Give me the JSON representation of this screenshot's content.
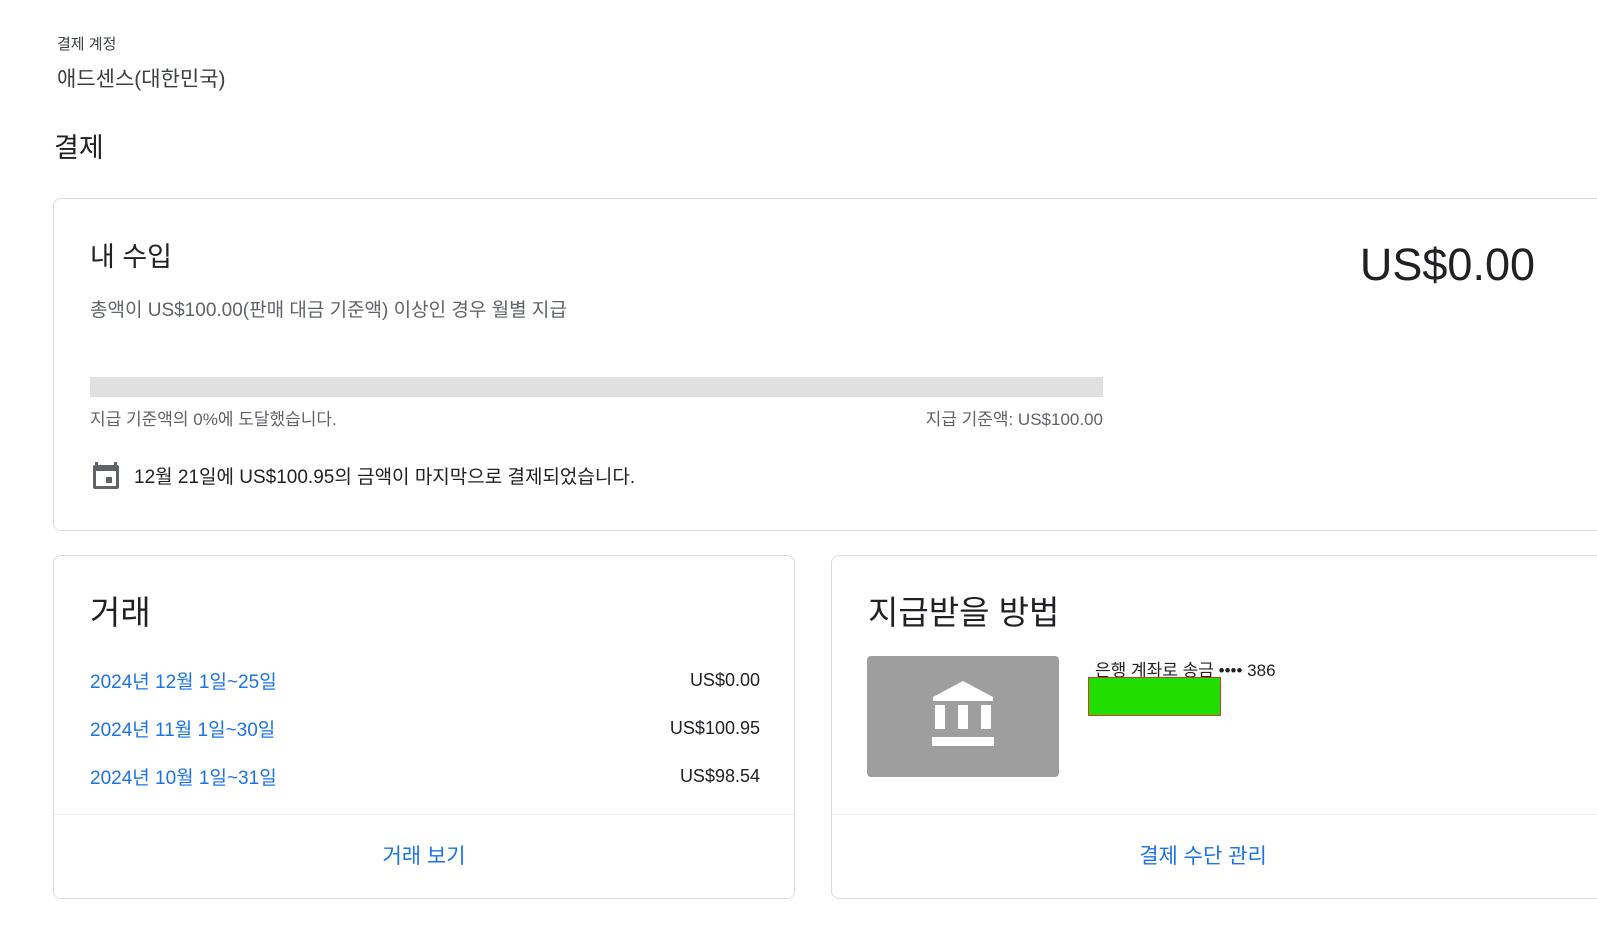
{
  "account": {
    "label": "결제 계정",
    "name": "애드센스(대한민국)"
  },
  "page": {
    "title": "결제"
  },
  "earnings": {
    "title": "내 수입",
    "description": "총액이 US$100.00(판매 대금 기준액) 이상인 경우 월별 지급",
    "balance": "US$0.00",
    "progress_fraction": 0,
    "progress_left": "지급 기준액의 0%에 도달했습니다.",
    "progress_right": "지급 기준액: US$100.00",
    "last_payment": "12월 21일에 US$100.95의 금액이 마지막으로 결제되었습니다.",
    "last_payment_icon": "calendar-icon"
  },
  "transactions": {
    "title": "거래",
    "rows": [
      {
        "period": "2024년 12월 1일~25일",
        "amount": "US$0.00"
      },
      {
        "period": "2024년 11월 1일~30일",
        "amount": "US$100.95"
      },
      {
        "period": "2024년 10월 1일~31일",
        "amount": "US$98.54"
      }
    ],
    "action": "거래 보기"
  },
  "payment_method": {
    "title": "지급받을 방법",
    "icon": "bank-icon",
    "label": "은행 계좌로 송금 •••• 386",
    "action": "결제 수단 관리"
  },
  "colors": {
    "link": "#1a73e8",
    "track": "#e0e0e0",
    "bank_tile": "#9e9e9e",
    "redaction": "#22dd00"
  }
}
